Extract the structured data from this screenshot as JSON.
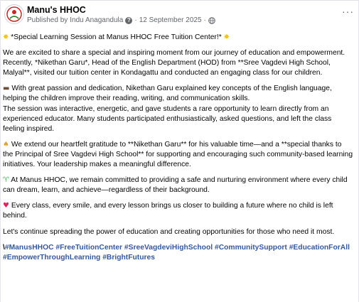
{
  "post": {
    "page_name": "Manu's HHOC",
    "published_by_label": "Published by",
    "author": "Indu Anagandula",
    "help_icon_glyph": "?",
    "separator": "·",
    "date": "12 September 2025",
    "globe_icon": "globe-icon",
    "more_icon_glyph": "···",
    "avatar_icon": "logo-avatar-icon"
  },
  "content": {
    "sparkle_glyph": "✸",
    "title": "*Special Learning Session at Manus HHOC Free Tuition Center!*",
    "p1": "We are excited to share a special and inspiring moment from our journey of education and empowerment.",
    "p2": "Recently, *Nikethan Garu*, Head of the English Department (HOD) from **Sree Vagdevi High School, Malyal**, visited our tuition center in Kondagattu and conducted an engaging class for our children.",
    "laptop_glyph": "▬",
    "p3": "With great passion and dedication, Nikethan Garu explained key concepts of the English language, helping the children improve their reading, writing, and communication skills.",
    "p4": "The session was interactive, energetic, and gave students a rare opportunity to learn directly from an experienced educator. Many students participated enthusiastically, asked questions, and left the class feeling inspired.",
    "pray_glyph": "♠",
    "p5": "We extend our heartfelt gratitude to **Nikethan Garu** for his valuable time—and a **special thanks to the Principal of Sree Vagdevi High School** for supporting and encouraging such community-based learning initiatives. Your leadership makes a meaningful difference.",
    "seedling_glyph": "♈",
    "p6": "At Manus HHOC, we remain committed to providing a safe and nurturing environment where every child can dream, learn, and achieve—regardless of their background.",
    "heart_glyph": "♥",
    "p7": "Every class, every smile, and every lesson brings us closer to building a future where no child is left behind.",
    "p8": "Let's continue spreading the power of education and creating opportunities for those who need it most.",
    "hashtag_prefix": "\\",
    "hashtags": [
      "#ManusHHOC",
      "#FreeTuitionCenter",
      "#SreeVagdeviHighSchool",
      "#CommunitySupport",
      "#EducationForAll",
      "#EmpowerThroughLearning",
      "#BrightFutures"
    ]
  },
  "colors": {
    "link": "#385898",
    "meta_text": "#65676b",
    "body_text": "#050505"
  }
}
